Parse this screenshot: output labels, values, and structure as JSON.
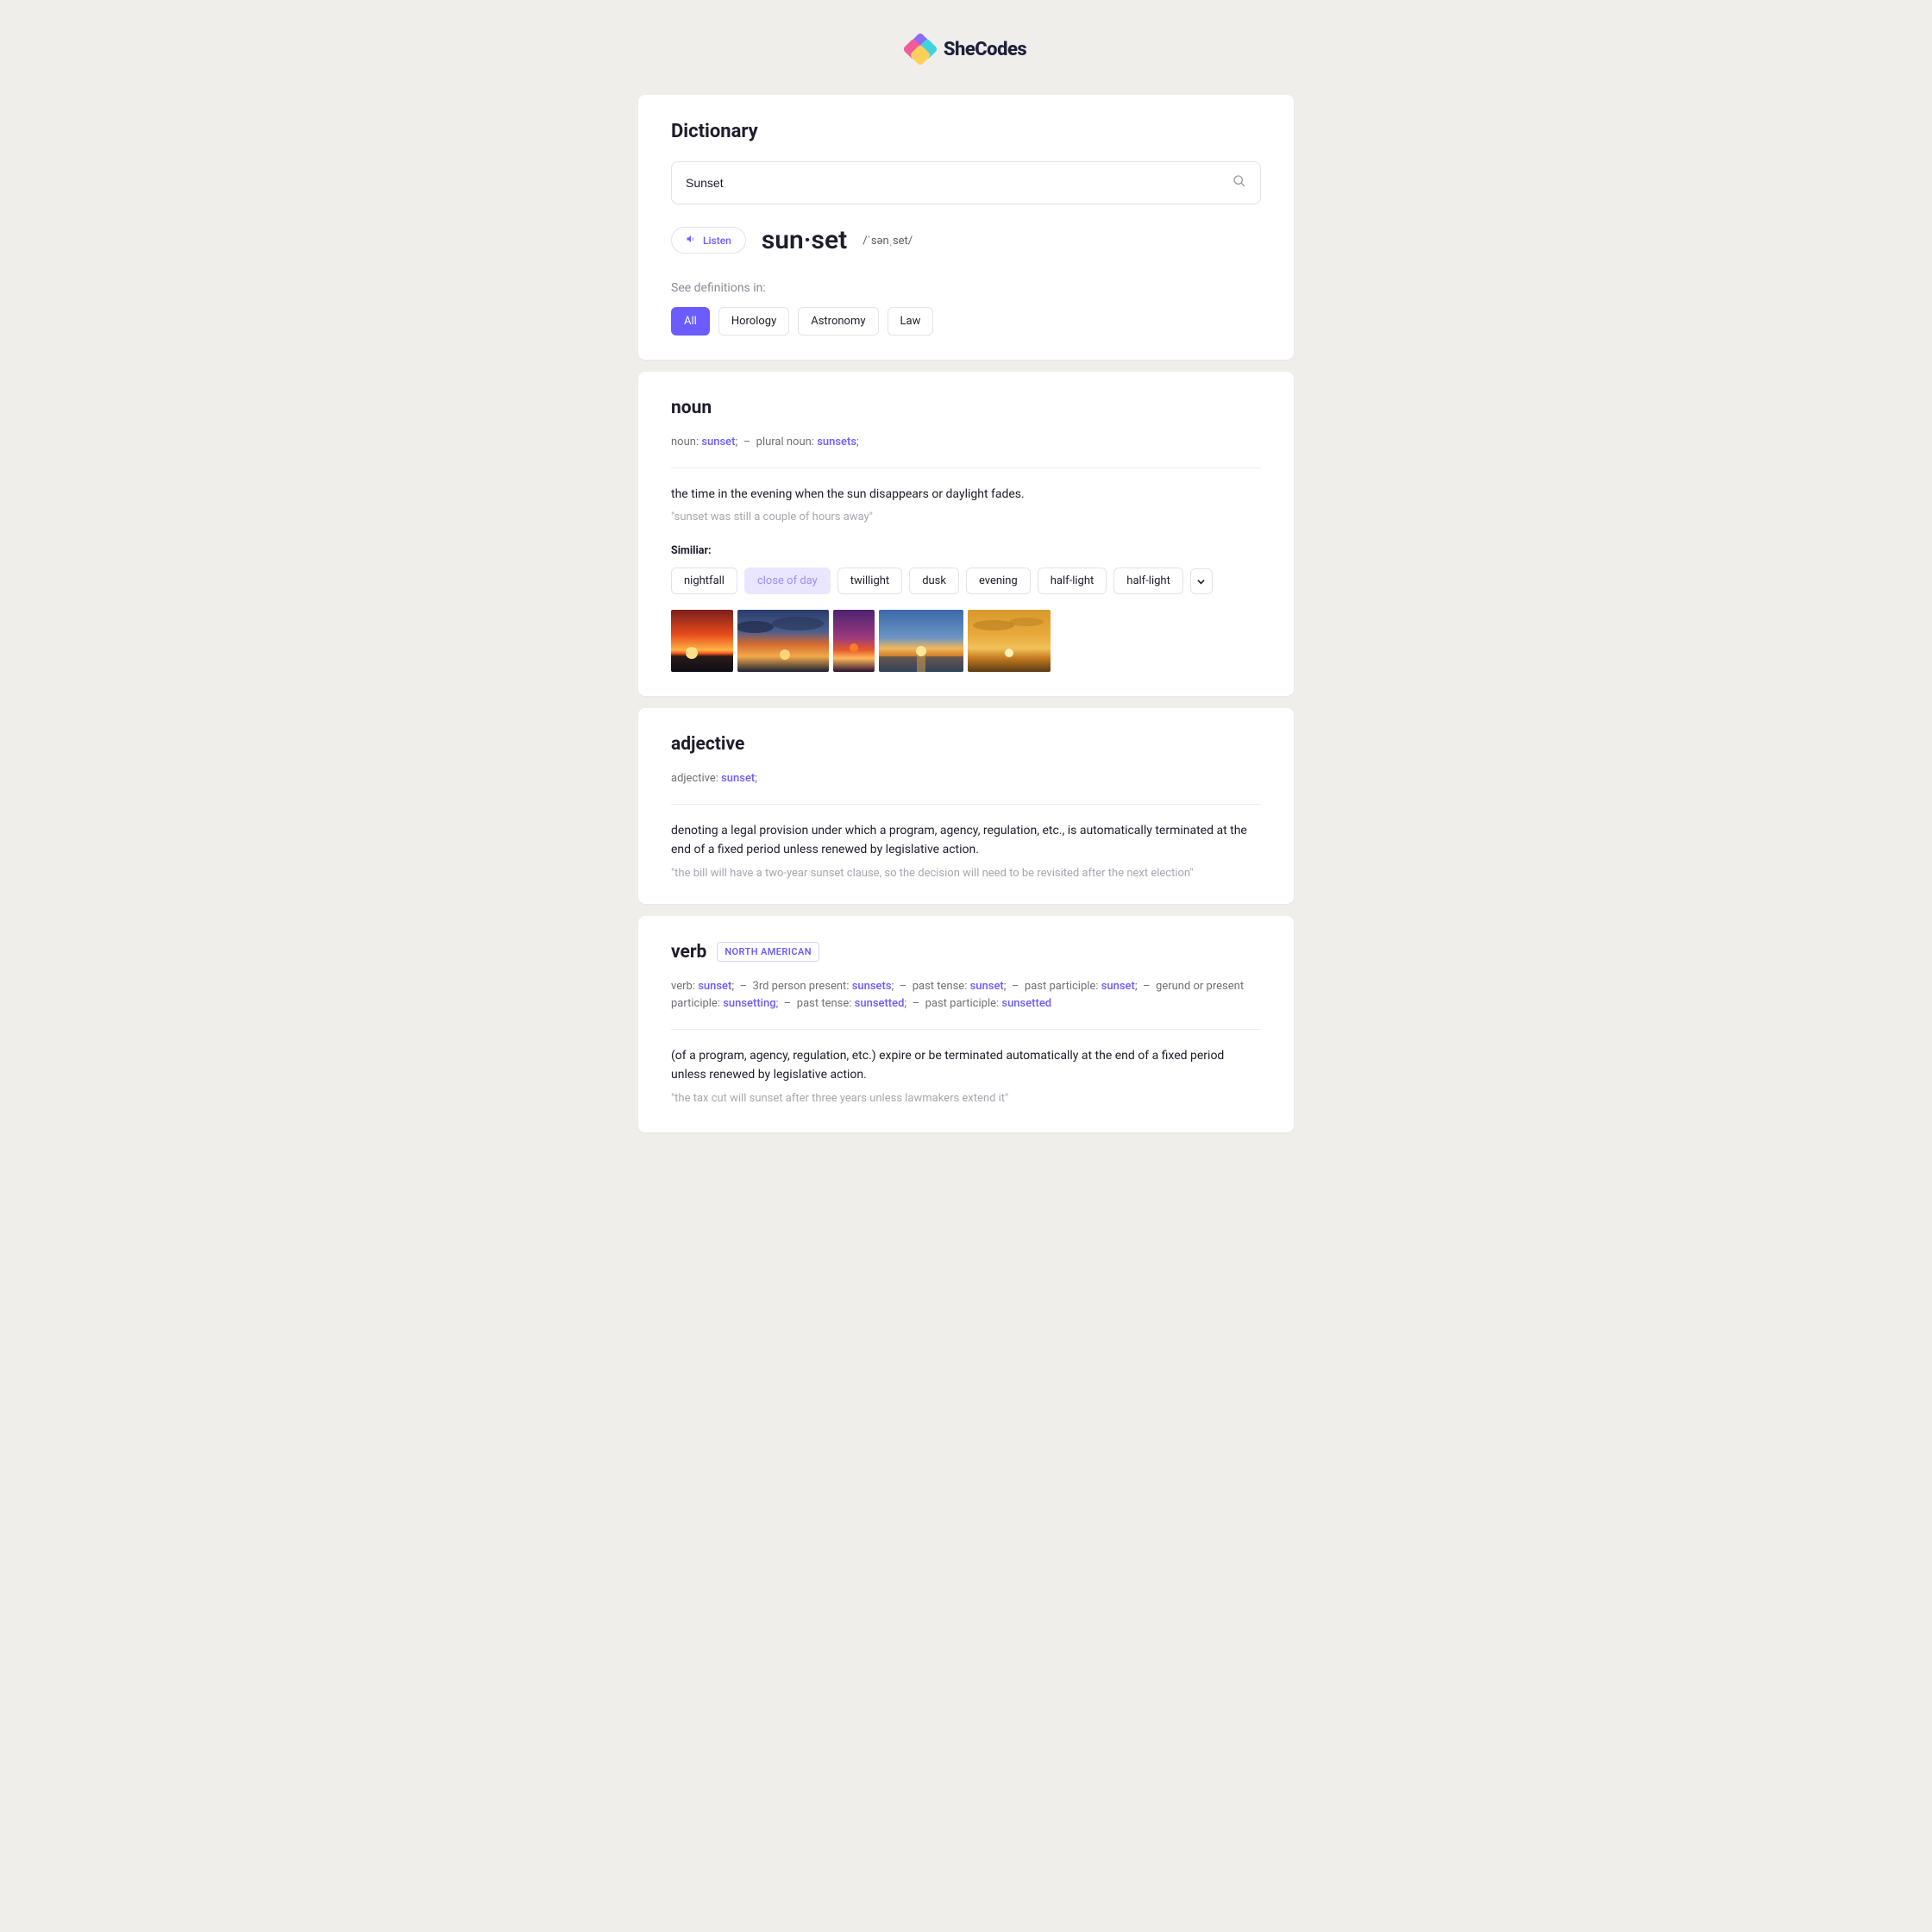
{
  "brand": {
    "name": "SheCodes"
  },
  "header": {
    "title": "Dictionary",
    "search_value": "Sunset",
    "listen_label": "Listen",
    "word_display": "sun·set",
    "phonetic": "/ˈsənˌset/",
    "see_defs_label": "See definitions in:",
    "categories": [
      "All",
      "Horology",
      "Astronomy",
      "Law"
    ],
    "active_category": "All"
  },
  "noun": {
    "title": "noun",
    "forms": [
      {
        "label": "noun: ",
        "word": "sunset",
        "trail": ";"
      },
      {
        "sep": true
      },
      {
        "label": "plural noun: ",
        "word": "sunsets",
        "trail": ";"
      }
    ],
    "definition": "the time in the evening when the sun disappears or daylight fades.",
    "quote": "\"sunset was still a couple of hours away\"",
    "similar_label": "Similiar:",
    "synonyms": [
      "nightfall",
      "close of day",
      "twillight",
      "dusk",
      "evening",
      "half-light",
      "half-light"
    ],
    "highlighted_synonym": "close of day"
  },
  "adjective": {
    "title": "adjective",
    "forms": [
      {
        "label": "adjective: ",
        "word": "sunset",
        "trail": ";"
      }
    ],
    "definition": "denoting a legal provision under which a program, agency, regulation, etc., is automatically terminated at the end of a fixed period unless renewed by legislative action.",
    "quote": "\"the bill will have a two-year sunset clause, so the decision will need to be revisited after the next election\""
  },
  "verb": {
    "title": "verb",
    "region": "NORTH AMERICAN",
    "forms": [
      {
        "label": "verb: ",
        "word": "sunset",
        "trail": ";"
      },
      {
        "sep": true
      },
      {
        "label": "3rd person present: ",
        "word": "sunsets",
        "trail": ";"
      },
      {
        "sep": true
      },
      {
        "label": "past tense: ",
        "word": "sunset",
        "trail": ";"
      },
      {
        "sep": true
      },
      {
        "label": "past participle: ",
        "word": "sunset",
        "trail": ";"
      },
      {
        "sep": true
      },
      {
        "label": "gerund or present participle: ",
        "word": "sunsetting",
        "trail": ";"
      },
      {
        "sep": true
      },
      {
        "label": "past tense: ",
        "word": "sunsetted",
        "trail": ";"
      },
      {
        "sep": true
      },
      {
        "label": "past participle: ",
        "word": "sunsetted",
        "trail": ""
      }
    ],
    "definition": "(of a program, agency, regulation, etc.) expire or be terminated automatically at the end of a fixed period unless renewed by legislative action.",
    "quote": "\"the tax cut will sunset after three years unless lawmakers extend it\""
  }
}
